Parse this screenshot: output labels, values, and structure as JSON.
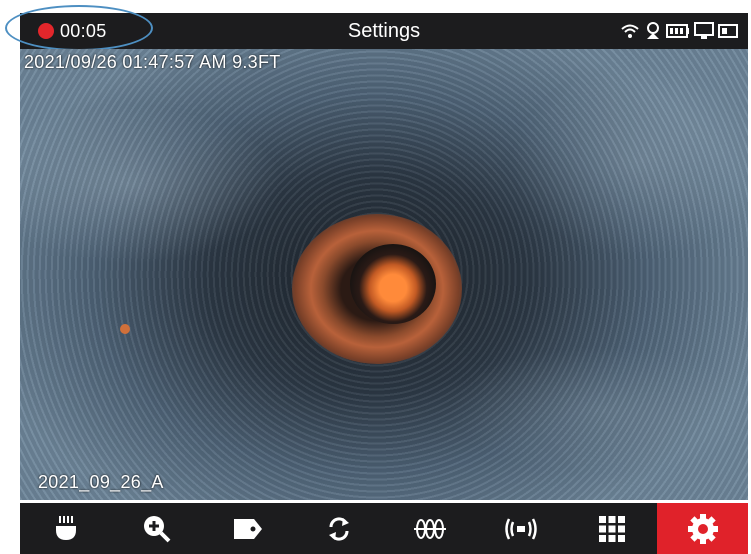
{
  "status_bar": {
    "recording_time": "00:05",
    "title": "Settings",
    "icons": [
      "wifi-icon",
      "temperature-icon",
      "battery-icon",
      "monitor-icon",
      "storage-icon"
    ]
  },
  "camera_view": {
    "timestamp_overlay": "2021/09/26 01:47:57 AM 9.3FT",
    "filename_overlay": "2021_09_26_A"
  },
  "toolbar": {
    "items": [
      {
        "name": "light-icon"
      },
      {
        "name": "zoom-in-icon"
      },
      {
        "name": "tag-icon"
      },
      {
        "name": "rotate-icon"
      },
      {
        "name": "meter-icon"
      },
      {
        "name": "transmitter-icon"
      },
      {
        "name": "grid-icon"
      },
      {
        "name": "settings-icon",
        "active": true
      }
    ],
    "active_color": "#e0222a"
  },
  "colors": {
    "bar_background": "#1c1c1e",
    "record_dot": "#e3262b",
    "highlight_ring": "#4d8fc2"
  }
}
